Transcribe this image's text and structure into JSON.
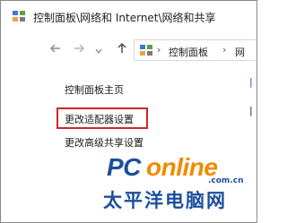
{
  "window": {
    "title": "控制面板\\网络和 Internet\\网络和共享"
  },
  "nav": {
    "back_icon": "arrow-left-icon",
    "forward_icon": "arrow-right-icon",
    "recent_icon": "chevron-down-icon",
    "up_icon": "arrow-up-icon"
  },
  "address": {
    "crumb_1": "控制面板",
    "crumb_2": "网"
  },
  "sidebar": {
    "home": "控制面板主页",
    "adapter_settings": "更改适配器设置",
    "advanced_sharing": "更改高级共享设置"
  },
  "watermark": {
    "brand_pc": "PC",
    "brand_online": "online",
    "brand_domain": ".com.cn",
    "brand_cn": "太平洋电脑网"
  },
  "colors": {
    "highlight": "#d2232a",
    "brand_blue": "#1c4f9c",
    "brand_orange": "#f08a00"
  }
}
